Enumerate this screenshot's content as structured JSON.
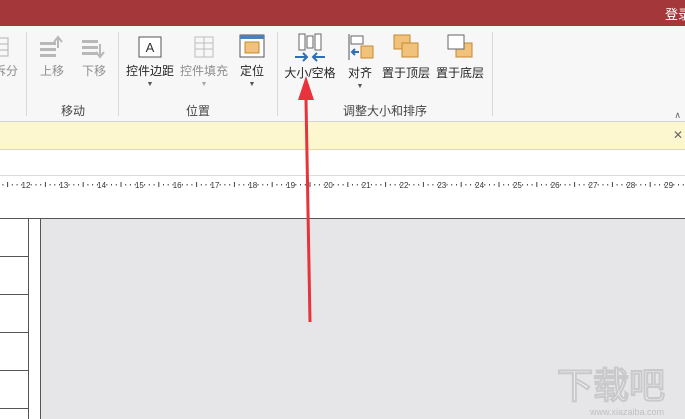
{
  "titlebar": {
    "login_label": "登录"
  },
  "ribbon": {
    "groups": {
      "move": {
        "label": "移动",
        "partial_label": "拆分",
        "up_label": "上移",
        "down_label": "下移"
      },
      "position": {
        "label": "位置",
        "control_margins_label": "控件边距",
        "control_padding_label": "控件填充",
        "anchoring_label": "定位"
      },
      "size": {
        "label": "调整大小和排序",
        "size_space_label": "大小/空格",
        "align_label": "对齐",
        "bring_front_label": "置于顶层",
        "send_back_label": "置于底层"
      }
    }
  },
  "ruler": {
    "numbers": [
      "12",
      "13",
      "14",
      "15",
      "16",
      "17",
      "18",
      "19",
      "20",
      "21",
      "22",
      "23",
      "24",
      "25",
      "26",
      "27",
      "28",
      "29"
    ]
  },
  "colors": {
    "titlebar": "#a4373a",
    "annotation_arrow": "#e8323c",
    "message_bar": "#fdf7d0",
    "canvas": "#e6e6e8"
  },
  "watermark": {
    "text": "下载吧",
    "subtext": "www.xiazaiba.com"
  }
}
